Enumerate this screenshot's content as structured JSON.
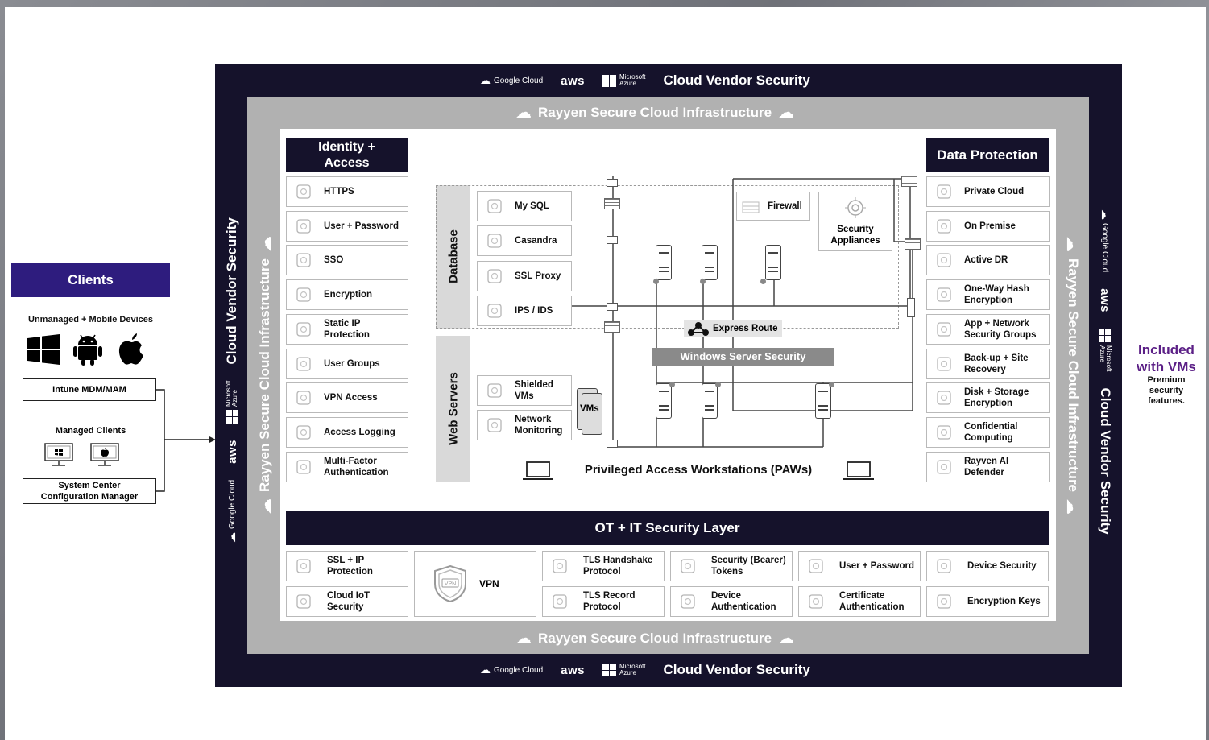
{
  "vendor_header": {
    "google_cloud": "Google Cloud",
    "aws": "aws",
    "microsoft_azure_line1": "Microsoft",
    "microsoft_azure_line2": "Azure",
    "title": "Cloud Vendor Security"
  },
  "infrastructure_label": "Rayyen Secure Cloud Infrastructure",
  "clients": {
    "title": "Clients",
    "unmanaged_label": "Unmanaged + Mobile Devices",
    "intune_label": "Intune MDM/MAM",
    "managed_label": "Managed Clients",
    "sccm_line1": "System Center",
    "sccm_line2": "Configuration Manager",
    "icons": [
      "windows-icon",
      "android-icon",
      "apple-icon"
    ]
  },
  "identity_access": {
    "title_line1": "Identity +",
    "title_line2": "Access",
    "items": [
      {
        "label": "HTTPS",
        "icon": "https-icon"
      },
      {
        "label": "User + Password",
        "icon": "lock-icon"
      },
      {
        "label": "SSO",
        "icon": "key-icon"
      },
      {
        "label": "Encryption",
        "icon": "shield-icon"
      },
      {
        "label": "Static IP\nProtection",
        "icon": "ip-shield-icon"
      },
      {
        "label": "User Groups",
        "icon": "users-icon"
      },
      {
        "label": "VPN Access",
        "icon": "vpn-shield-icon"
      },
      {
        "label": "Access Logging",
        "icon": "log-icon"
      },
      {
        "label": "Multi-Factor\nAuthentication",
        "icon": "mfa-icon"
      }
    ]
  },
  "data_protection": {
    "title": "Data Protection",
    "items": [
      {
        "label": "Private Cloud",
        "icon": "cloud-icon"
      },
      {
        "label": "On Premise",
        "icon": "location-icon"
      },
      {
        "label": "Active DR",
        "icon": "cloud-sync-icon"
      },
      {
        "label": "One-Way Hash\nEncryption",
        "icon": "shield-check-icon"
      },
      {
        "label": "App + Network\nSecurity Groups",
        "icon": "app-lock-icon"
      },
      {
        "label": "Back-up + Site\nRecovery",
        "icon": "network-icon"
      },
      {
        "label": "Disk + Storage\nEncryption",
        "icon": "disk-icon"
      },
      {
        "label": "Confidential\nComputing",
        "icon": "padlock-icon"
      },
      {
        "label": "Rayven AI\nDefender",
        "icon": "rayven-logo-icon"
      }
    ]
  },
  "database": {
    "label": "Database",
    "items": [
      "My SQL",
      "Casandra",
      "SSL Proxy",
      "IPS / IDS"
    ]
  },
  "web_servers": {
    "label": "Web Servers",
    "items": [
      "Shielded\nVMs",
      "Network\nMonitoring"
    ],
    "vms_label": "VMs"
  },
  "network": {
    "firewall": "Firewall",
    "security_appliances_line1": "Security",
    "security_appliances_line2": "Appliances",
    "express_route": "Express Route",
    "windows_server_security": "Windows Server Security",
    "paws": "Privileged Access Workstations (PAWs)"
  },
  "ot_it": {
    "title": "OT + IT Security Layer",
    "vpn": "VPN",
    "vpn_badge": "VPN",
    "items": [
      {
        "label": "SSL + IP\nProtection",
        "icon": "ssl-icon"
      },
      {
        "label": "Cloud IoT\nSecurity",
        "icon": "cloud-iot-icon"
      },
      {
        "label": "TLS Handshake\nProtocol",
        "icon": "handshake-icon"
      },
      {
        "label": "TLS Record\nProtocol",
        "icon": "document-icon"
      },
      {
        "label": "Security (Bearer)\nTokens",
        "icon": "token-icon"
      },
      {
        "label": "Device\nAuthentication",
        "icon": "device-auth-icon"
      },
      {
        "label": "User + Password",
        "icon": "user-lock-icon"
      },
      {
        "label": "Certificate\nAuthentication",
        "icon": "certificate-icon"
      },
      {
        "label": "Device Security",
        "icon": "device-security-icon"
      },
      {
        "label": "Encryption Keys",
        "icon": "key-lock-icon"
      }
    ]
  },
  "included": {
    "title_line1": "Included",
    "title_line2": "with VMs",
    "sub_line1": "Premium",
    "sub_line2": "security",
    "sub_line3": "features."
  },
  "colors": {
    "navy": "#15122b",
    "clients_purple": "#2e1c7e",
    "included_purple": "#5b1f86",
    "frame_grey": "#b1b1b1"
  }
}
